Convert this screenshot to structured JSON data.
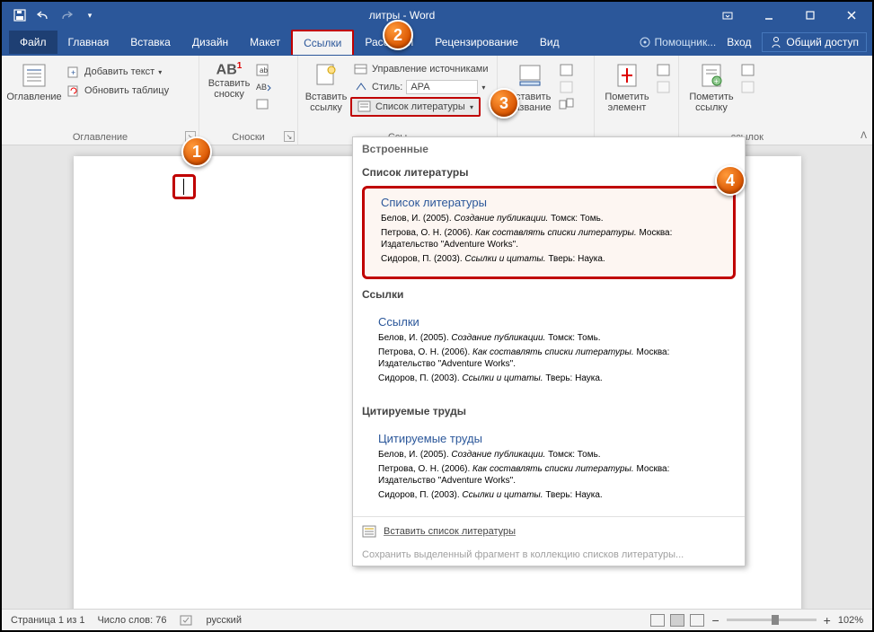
{
  "titlebar": {
    "title": "литры - Word"
  },
  "menu": {
    "file": "Файл",
    "tabs": [
      "Главная",
      "Вставка",
      "Дизайн",
      "Макет",
      "Ссылки",
      "Рассылки",
      "Рецензирование",
      "Вид"
    ],
    "active_index": 4,
    "assist": "Помощник...",
    "login": "Вход",
    "share": "Общий доступ"
  },
  "ribbon": {
    "toc": {
      "big": "Оглавление",
      "add_text": "Добавить текст",
      "update": "Обновить таблицу",
      "group": "Оглавление"
    },
    "footnotes": {
      "big": "Вставить\nсноску",
      "ab": "AB",
      "group": "Сноски"
    },
    "citations": {
      "big": "Вставить\nссылку",
      "manage": "Управление источниками",
      "style_label": "Стиль:",
      "style_value": "APA",
      "biblio": "Список литературы",
      "group": "Ссы"
    },
    "captions": {
      "big": "Вставить\nназвание"
    },
    "index": {
      "big": "Пометить\nэлемент"
    },
    "toa": {
      "big": "Пометить\nссылку",
      "group_suffix": "ссылок"
    }
  },
  "dropdown": {
    "builtin": "Встроенные",
    "sections": [
      {
        "header": "Список литературы",
        "title": "Список литературы",
        "highlighted": true
      },
      {
        "header": "Ссылки",
        "title": "Ссылки",
        "highlighted": false
      },
      {
        "header": "Цитируемые труды",
        "title": "Цитируемые труды",
        "highlighted": false
      }
    ],
    "entries": [
      {
        "author": "Белов, И. (2005).",
        "work": "Создание публикации.",
        "rest": " Томск: Томь."
      },
      {
        "author": "Петрова, О. Н. (2006).",
        "work": "Как составлять списки литературы.",
        "rest": " Москва: Издательство \"Adventure Works\"."
      },
      {
        "author": "Сидоров, П. (2003).",
        "work": "Ссылки и цитаты.",
        "rest": " Тверь: Наука."
      }
    ],
    "insert": "Вставить список литературы",
    "save_sel": "Сохранить выделенный фрагмент в коллекцию списков литературы..."
  },
  "statusbar": {
    "page": "Страница 1 из 1",
    "words": "Число слов: 76",
    "lang": "русский",
    "zoom": "102%"
  },
  "markers": {
    "m1": "1",
    "m2": "2",
    "m3": "3",
    "m4": "4"
  }
}
